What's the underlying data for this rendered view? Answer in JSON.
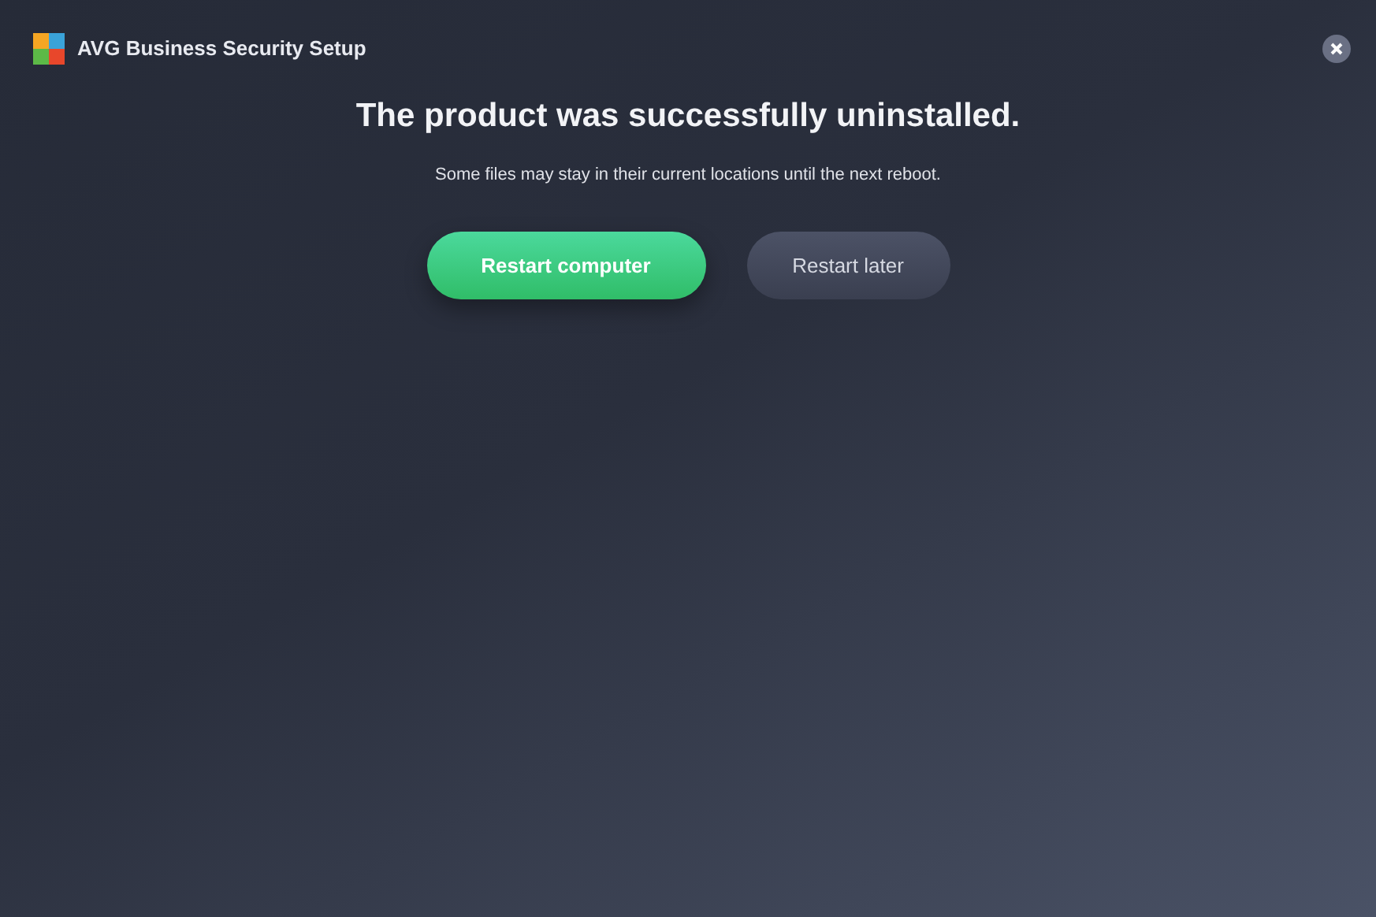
{
  "window": {
    "title": "AVG Business Security Setup"
  },
  "heading": "The product was successfully uninstalled.",
  "message": "Some files may stay in their current locations until the next reboot.",
  "buttons": [
    {
      "label": "Restart computer",
      "kind": "primary"
    },
    {
      "label": "Restart later",
      "kind": "secondary"
    }
  ]
}
